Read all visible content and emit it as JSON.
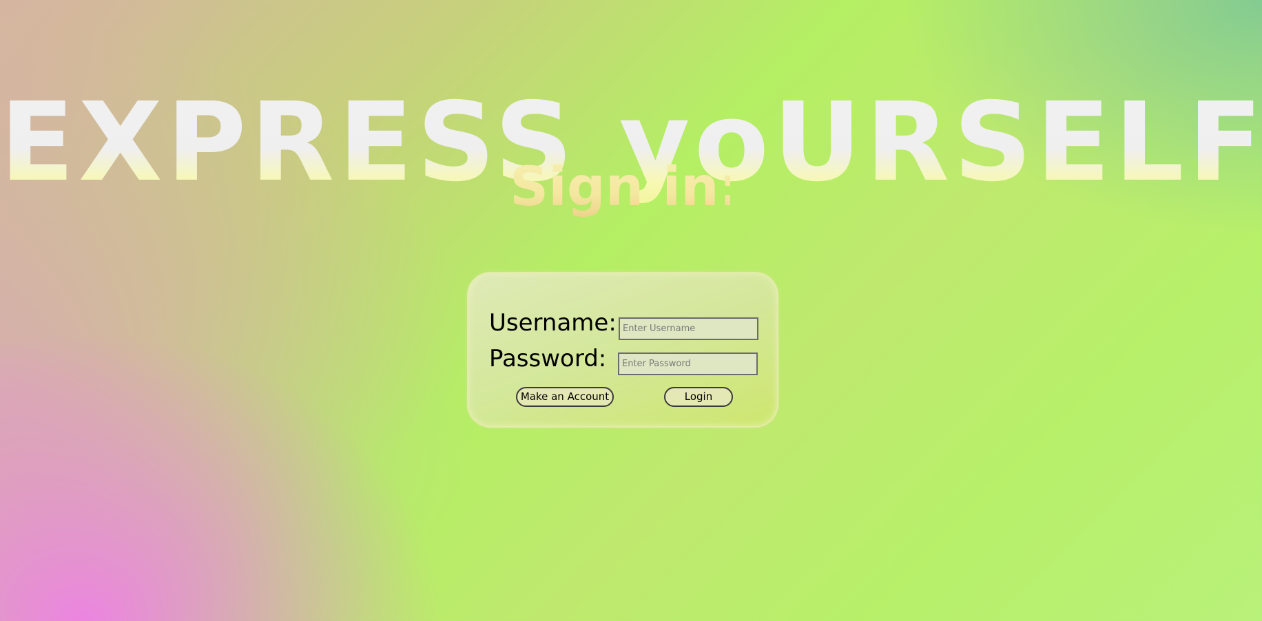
{
  "header": {
    "title": "EXPRESS yoURSELF",
    "subtitle": "Sign in:"
  },
  "login_form": {
    "username_label": "Username:",
    "username_placeholder": "Enter Username",
    "username_value": "",
    "password_label": "Password:",
    "password_placeholder": "Enter Password",
    "password_value": "",
    "make_account_label": "Make an Account",
    "login_label": "Login"
  },
  "colors": {
    "title_text": "#efefef",
    "subtitle_text": "#f6eea4",
    "background_green": "#b4ef64",
    "background_pink": "#ee80e6",
    "card_fill": "#dfe6b4"
  }
}
